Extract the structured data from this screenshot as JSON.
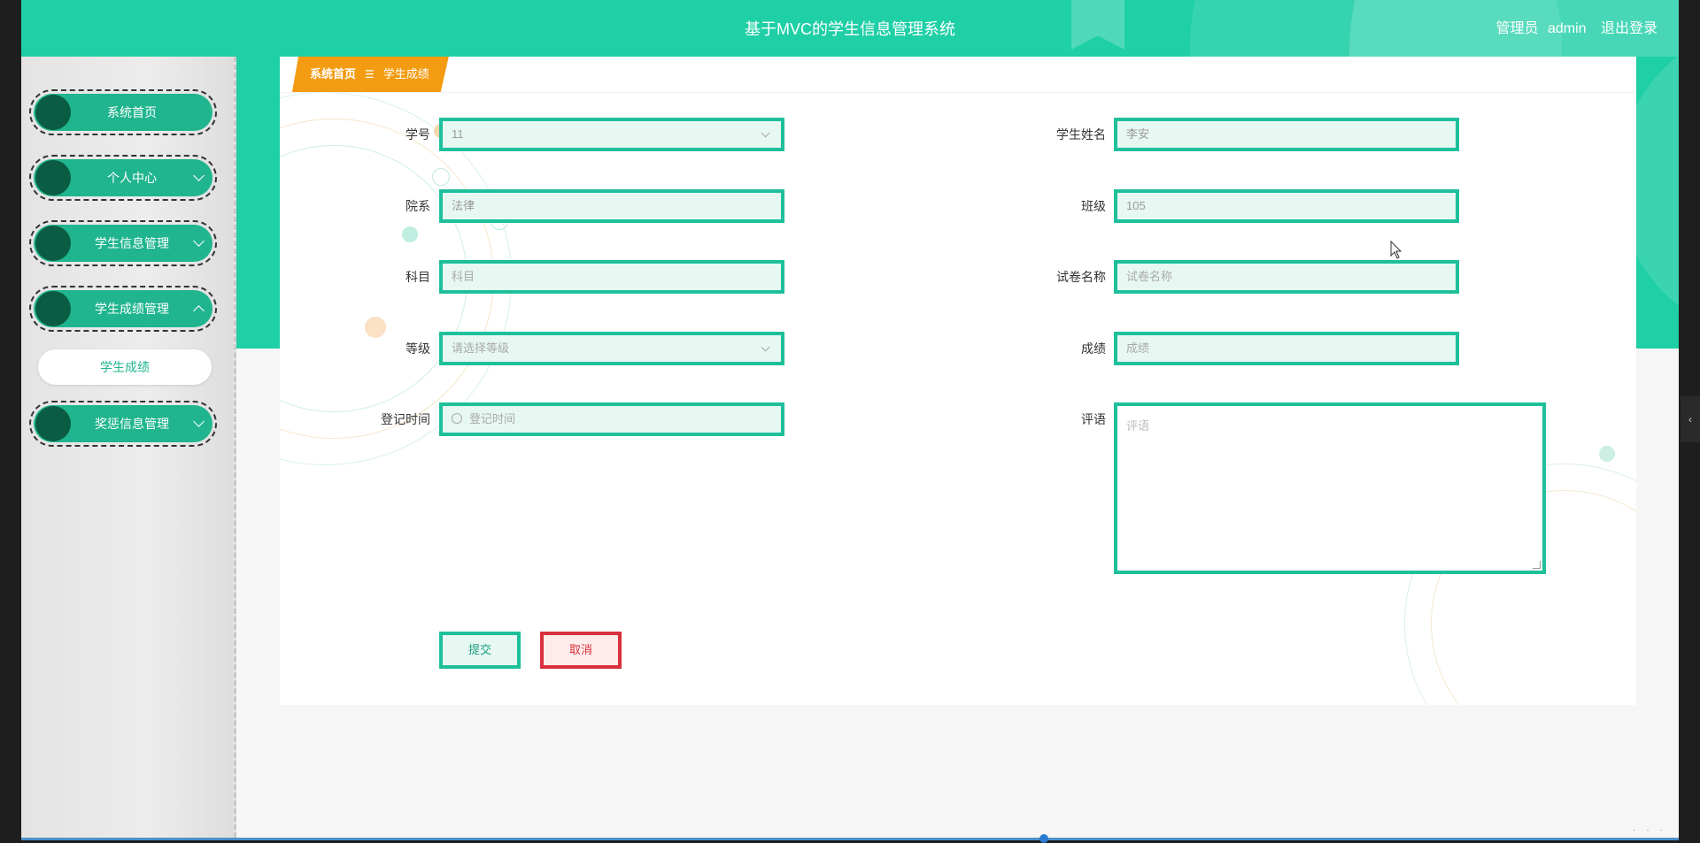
{
  "header": {
    "title": "基于MVC的学生信息管理系统",
    "user_role": "管理员",
    "username": "admin",
    "logout": "退出登录"
  },
  "sidebar": {
    "items": [
      {
        "label": "系统首页",
        "chevron": "none"
      },
      {
        "label": "个人中心",
        "chevron": "down"
      },
      {
        "label": "学生信息管理",
        "chevron": "down"
      },
      {
        "label": "学生成绩管理",
        "chevron": "up"
      },
      {
        "label": "奖惩信息管理",
        "chevron": "down"
      }
    ],
    "submenu": {
      "label": "学生成绩"
    }
  },
  "breadcrumb": {
    "home": "系统首页",
    "separator": "☰",
    "current": "学生成绩"
  },
  "form": {
    "student_no": {
      "label": "学号",
      "value": "11"
    },
    "student_name": {
      "label": "学生姓名",
      "value": "李安"
    },
    "department": {
      "label": "院系",
      "value": "法律"
    },
    "class": {
      "label": "班级",
      "value": "105"
    },
    "subject": {
      "label": "科目",
      "placeholder": "科目"
    },
    "paper_name": {
      "label": "试卷名称",
      "placeholder": "试卷名称"
    },
    "grade_level": {
      "label": "等级",
      "placeholder": "请选择等级"
    },
    "score": {
      "label": "成绩",
      "placeholder": "成绩"
    },
    "register_time": {
      "label": "登记时间",
      "placeholder": "登记时间"
    },
    "comment": {
      "label": "评语",
      "placeholder": "评语"
    },
    "submit": "提交",
    "cancel": "取消"
  },
  "colors": {
    "primary": "#1fcfa6",
    "sidebar_pill": "#20b58e",
    "knob": "#0a5c42",
    "breadcrumb": "#f39c12",
    "cancel": "#d9303d"
  }
}
